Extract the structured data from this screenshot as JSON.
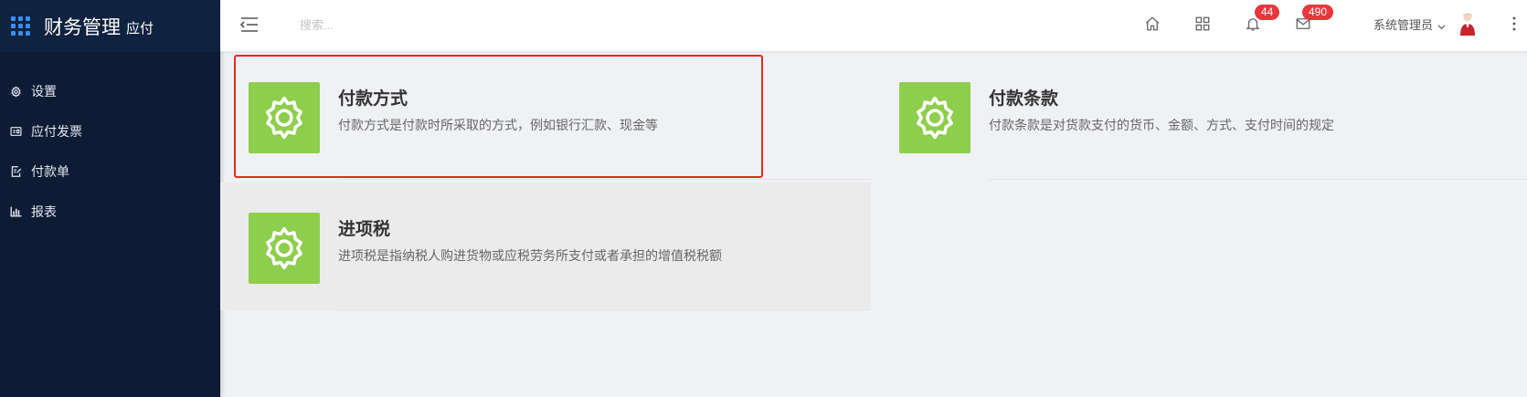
{
  "app": {
    "title": "财务管理",
    "subtitle": "应付"
  },
  "sidebar": {
    "items": [
      {
        "label": "设置",
        "icon": "gear-icon"
      },
      {
        "label": "应付发票",
        "icon": "invoice-icon"
      },
      {
        "label": "付款单",
        "icon": "payment-doc-icon"
      },
      {
        "label": "报表",
        "icon": "bar-chart-icon"
      }
    ]
  },
  "header": {
    "search_placeholder": "搜索...",
    "notifications_count": "44",
    "messages_count": "490",
    "user_name": "系统管理员"
  },
  "cards": [
    {
      "title": "付款方式",
      "description": "付款方式是付款时所采取的方式，例如银行汇款、现金等"
    },
    {
      "title": "付款条款",
      "description": "付款条款是对货款支付的货币、金额、方式、支付时间的规定"
    },
    {
      "title": "进项税",
      "description": "进项税是指纳税人购进货物或应税劳务所支付或者承担的增值税税额"
    }
  ],
  "colors": {
    "sidebar_bg": "#0d1b35",
    "accent_blue": "#3a8ef6",
    "card_icon_green": "#8dce4c",
    "badge_red": "#e8383d",
    "selection_red": "#e52a22"
  }
}
